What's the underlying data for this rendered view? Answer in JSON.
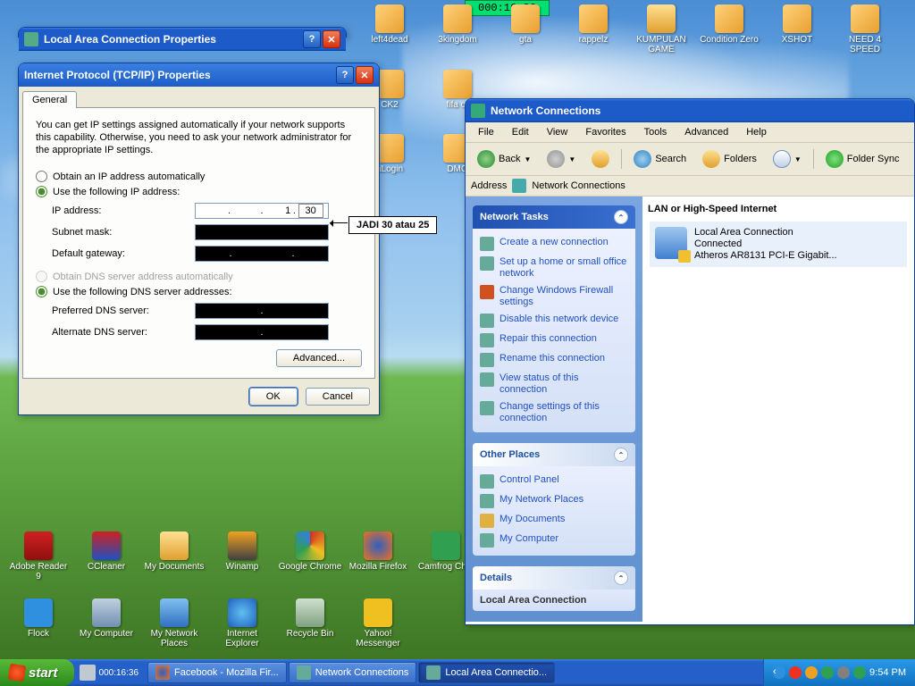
{
  "timer": "000:16:36",
  "desktop_row1": [
    "left4dead",
    "3kingdom",
    "gta",
    "rappelz",
    "KUMPULAN GAME",
    "Condition Zero",
    "XSHOT",
    "NEED 4 SPEED"
  ],
  "desktop_row2": [
    "CK2",
    "fifa or",
    "",
    "",
    "",
    "",
    "",
    ""
  ],
  "desktop_row3": [
    "aLogin",
    "DMG"
  ],
  "desktop_bottom1": [
    "Adobe Reader 9",
    "CCleaner",
    "My Documents",
    "Winamp",
    "Google Chrome",
    "Mozilla Firefox",
    "Camfrog Chat"
  ],
  "desktop_bottom2": [
    "Flock",
    "My Computer",
    "My Network Places",
    "Internet Explorer",
    "Recycle Bin",
    "Yahoo! Messenger"
  ],
  "lac": {
    "title": "Local Area Connection Properties"
  },
  "tcp": {
    "title": "Internet Protocol (TCP/IP) Properties",
    "tab": "General",
    "desc": "You can get IP settings assigned automatically if your network supports this capability. Otherwise, you need to ask your network administrator for the appropriate IP settings.",
    "r1": "Obtain an IP address automatically",
    "r2": "Use the following IP address:",
    "ip_label": "IP address:",
    "ip_o3": "1",
    "ip_o4": "30",
    "subnet_label": "Subnet mask:",
    "gateway_label": "Default gateway:",
    "r3": "Obtain DNS server address automatically",
    "r4": "Use the following DNS server addresses:",
    "pdns_label": "Preferred DNS server:",
    "adns_label": "Alternate DNS server:",
    "advanced": "Advanced...",
    "ok": "OK",
    "cancel": "Cancel"
  },
  "callout": "JADI 30 atau 25",
  "nc": {
    "title": "Network Connections",
    "menus": [
      "File",
      "Edit",
      "View",
      "Favorites",
      "Tools",
      "Advanced",
      "Help"
    ],
    "back": "Back",
    "search": "Search",
    "folders": "Folders",
    "sync": "Folder Sync",
    "addr_label": "Address",
    "addr_value": "Network Connections",
    "tasks_head": "Network Tasks",
    "tasks": [
      "Create a new connection",
      "Set up a home or small office network",
      "Change Windows Firewall settings",
      "Disable this network device",
      "Repair this connection",
      "Rename this connection",
      "View status of this connection",
      "Change settings of this connection"
    ],
    "other_head": "Other Places",
    "other": [
      "Control Panel",
      "My Network Places",
      "My Documents",
      "My Computer"
    ],
    "details_head": "Details",
    "details_sub": "Local Area Connection",
    "cat": "LAN or High-Speed Internet",
    "conn_name": "Local Area Connection",
    "conn_status": "Connected",
    "conn_dev": "Atheros AR8131 PCI-E Gigabit..."
  },
  "taskbar": {
    "start": "start",
    "ql_timer": "000:16:36",
    "btns": [
      "Facebook - Mozilla Fir...",
      "Network Connections",
      "Local Area Connectio..."
    ],
    "clock": "9:54 PM"
  }
}
